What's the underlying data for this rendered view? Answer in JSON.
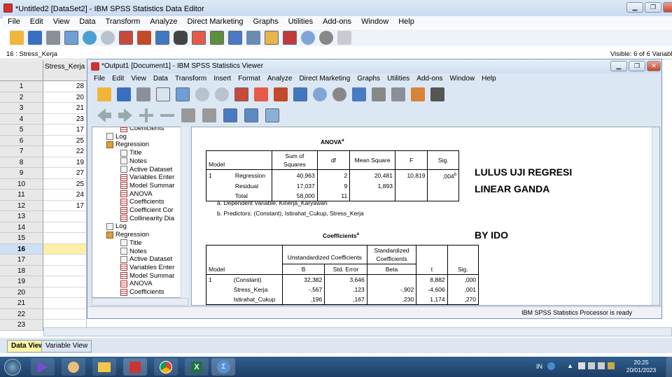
{
  "editor": {
    "title": "*Untitled2 [DataSet2] - IBM SPSS Statistics Data Editor",
    "menu": [
      "File",
      "Edit",
      "View",
      "Data",
      "Transform",
      "Analyze",
      "Direct Marketing",
      "Graphs",
      "Utilities",
      "Add-ons",
      "Window",
      "Help"
    ],
    "cell_ref": "16 : Stress_Kerja",
    "visible_vars": "Visible: 6 of 6 Variables",
    "column_header": "Stress_Kerja",
    "rows": [
      "1",
      "2",
      "3",
      "4",
      "5",
      "6",
      "7",
      "8",
      "9",
      "10",
      "11",
      "12",
      "13",
      "14",
      "15",
      "16",
      "17",
      "18",
      "19",
      "20",
      "21",
      "22",
      "23"
    ],
    "values": [
      "28",
      "20",
      "21",
      "23",
      "17",
      "25",
      "22",
      "19",
      "27",
      "25",
      "24",
      "17",
      "",
      "",
      "",
      "",
      "",
      "",
      "",
      "",
      "",
      "",
      ""
    ],
    "tab_data_view": "Data View",
    "tab_variable_view": "Variable View"
  },
  "viewer": {
    "title": "*Output1 [Document1] - IBM SPSS Statistics Viewer",
    "menu": [
      "File",
      "Edit",
      "View",
      "Data",
      "Transform",
      "Insert",
      "Format",
      "Analyze",
      "Direct Marketing",
      "Graphs",
      "Utilities",
      "Add-ons",
      "Window",
      "Help"
    ],
    "tree": [
      {
        "label": "Coefficients",
        "indent": 2,
        "icon": "tbl"
      },
      {
        "label": "Log",
        "indent": 1,
        "icon": "log"
      },
      {
        "label": "Regression",
        "indent": 1,
        "icon": "book"
      },
      {
        "label": "Title",
        "indent": 2,
        "icon": "doc"
      },
      {
        "label": "Notes",
        "indent": 2,
        "icon": "doc"
      },
      {
        "label": "Active Dataset",
        "indent": 2,
        "icon": "doc"
      },
      {
        "label": "Variables Enter",
        "indent": 2,
        "icon": "tbl"
      },
      {
        "label": "Model Summar",
        "indent": 2,
        "icon": "tbl"
      },
      {
        "label": "ANOVA",
        "indent": 2,
        "icon": "tbl"
      },
      {
        "label": "Coefficients",
        "indent": 2,
        "icon": "tbl"
      },
      {
        "label": "Coefficient Cor",
        "indent": 2,
        "icon": "tbl"
      },
      {
        "label": "Collinearity Dia",
        "indent": 2,
        "icon": "tbl"
      },
      {
        "label": "Log",
        "indent": 1,
        "icon": "log"
      },
      {
        "label": "Regression",
        "indent": 1,
        "icon": "book"
      },
      {
        "label": "Title",
        "indent": 2,
        "icon": "doc"
      },
      {
        "label": "Notes",
        "indent": 2,
        "icon": "doc"
      },
      {
        "label": "Active Dataset",
        "indent": 2,
        "icon": "doc"
      },
      {
        "label": "Variables Enter",
        "indent": 2,
        "icon": "tbl"
      },
      {
        "label": "Model Summar",
        "indent": 2,
        "icon": "tbl"
      },
      {
        "label": "ANOVA",
        "indent": 2,
        "icon": "tbl"
      },
      {
        "label": "Coefficients",
        "indent": 2,
        "icon": "tbl"
      }
    ],
    "anova": {
      "title": "ANOVA",
      "title_sup": "a",
      "headers": {
        "model": "Model",
        "ss": "Sum of Squares",
        "df": "df",
        "ms": "Mean Square",
        "f": "F",
        "sig": "Sig."
      },
      "rows": [
        {
          "model": "1",
          "name": "Regression",
          "ss": "40,963",
          "df": "2",
          "ms": "20,481",
          "f": "10,819",
          "sig": ",004",
          "sig_sup": "b"
        },
        {
          "model": "",
          "name": "Residual",
          "ss": "17,037",
          "df": "9",
          "ms": "1,893",
          "f": "",
          "sig": ""
        },
        {
          "model": "",
          "name": "Total",
          "ss": "58,000",
          "df": "11",
          "ms": "",
          "f": "",
          "sig": ""
        }
      ],
      "footnote_a": "a. Dependent Variable: Kinerja_Karyawan",
      "footnote_b": "b. Predictors: (Constant), Istirahat_Cukup, Stress_Kerja"
    },
    "coefficients": {
      "title": "Coefficients",
      "title_sup": "a",
      "headers": {
        "model": "Model",
        "unstd": "Unstandardized Coefficients",
        "std": "Standardized Coefficients",
        "b": "B",
        "se": "Std. Error",
        "beta": "Beta",
        "t": "t",
        "sig": "Sig."
      },
      "rows": [
        {
          "model": "1",
          "name": "(Constant)",
          "b": "32,382",
          "se": "3,646",
          "beta": "",
          "t": "8,882",
          "sig": ",000"
        },
        {
          "model": "",
          "name": "Stress_Kerja",
          "b": "-,567",
          "se": ",123",
          "beta": "-,902",
          "t": "-4,606",
          "sig": ",001"
        },
        {
          "model": "",
          "name": "Istirahat_Cukup",
          "b": ",196",
          "se": ",167",
          "beta": ",230",
          "t": "1,174",
          "sig": ",270"
        }
      ]
    },
    "annotation_line1": "LULUS UJI REGRESI",
    "annotation_line2": "LINEAR GANDA",
    "annotation_by": "BY IDO",
    "status": "IBM SPSS Statistics Processor is ready"
  },
  "taskbar": {
    "lang": "IN",
    "time": "20:25",
    "date": "20/01/2023"
  }
}
